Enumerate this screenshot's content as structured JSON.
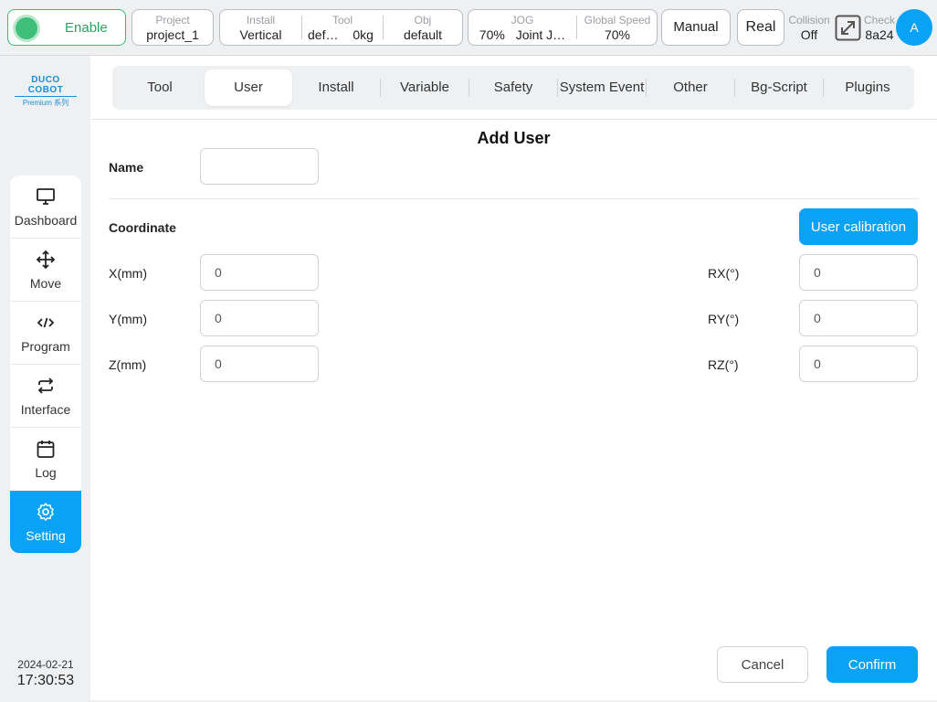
{
  "topbar": {
    "enable_label": "Enable",
    "project": {
      "caption": "Project",
      "value": "project_1"
    },
    "install": {
      "caption": "Install",
      "value": "Vertical"
    },
    "tool": {
      "caption": "Tool",
      "name": "def…",
      "weight": "0kg"
    },
    "obj": {
      "caption": "Obj",
      "value": "default"
    },
    "jog": {
      "caption": "JOG",
      "percent": "70%",
      "mode": "Joint J…"
    },
    "global_speed": {
      "caption": "Global Speed",
      "value": "70%"
    },
    "mode_button": "Manual",
    "real_button": "Real",
    "collision": {
      "caption": "Collision",
      "value": "Off"
    },
    "check": {
      "caption": "Check",
      "value": "8a24"
    },
    "avatar_initial": "A"
  },
  "logo": {
    "brand": "DUCO COBOT",
    "sub": "Premium 系列"
  },
  "sidebar": {
    "items": [
      {
        "label": "Dashboard",
        "icon": "monitor-icon"
      },
      {
        "label": "Move",
        "icon": "move-arrows-icon"
      },
      {
        "label": "Program",
        "icon": "code-icon"
      },
      {
        "label": "Interface",
        "icon": "swap-arrows-icon"
      },
      {
        "label": "Log",
        "icon": "calendar-icon"
      },
      {
        "label": "Setting",
        "icon": "gear-icon",
        "active": true
      }
    ]
  },
  "clock": {
    "date": "2024-02-21",
    "time": "17:30:53"
  },
  "tabs": [
    "Tool",
    "User",
    "Install",
    "Variable",
    "Safety",
    "System Event",
    "Other",
    "Bg-Script",
    "Plugins"
  ],
  "active_tab": "User",
  "form": {
    "title": "Add User",
    "name_label": "Name",
    "name_value": "",
    "coordinate_label": "Coordinate",
    "calibration_button": "User calibration",
    "x": {
      "label": "X(mm)",
      "value": "0"
    },
    "y": {
      "label": "Y(mm)",
      "value": "0"
    },
    "z": {
      "label": "Z(mm)",
      "value": "0"
    },
    "rx": {
      "label": "RX(°)",
      "value": "0"
    },
    "ry": {
      "label": "RY(°)",
      "value": "0"
    },
    "rz": {
      "label": "RZ(°)",
      "value": "0"
    }
  },
  "footer": {
    "cancel": "Cancel",
    "confirm": "Confirm"
  },
  "colors": {
    "accent": "#0aa2f5",
    "enable_green": "#3fbf7a"
  }
}
